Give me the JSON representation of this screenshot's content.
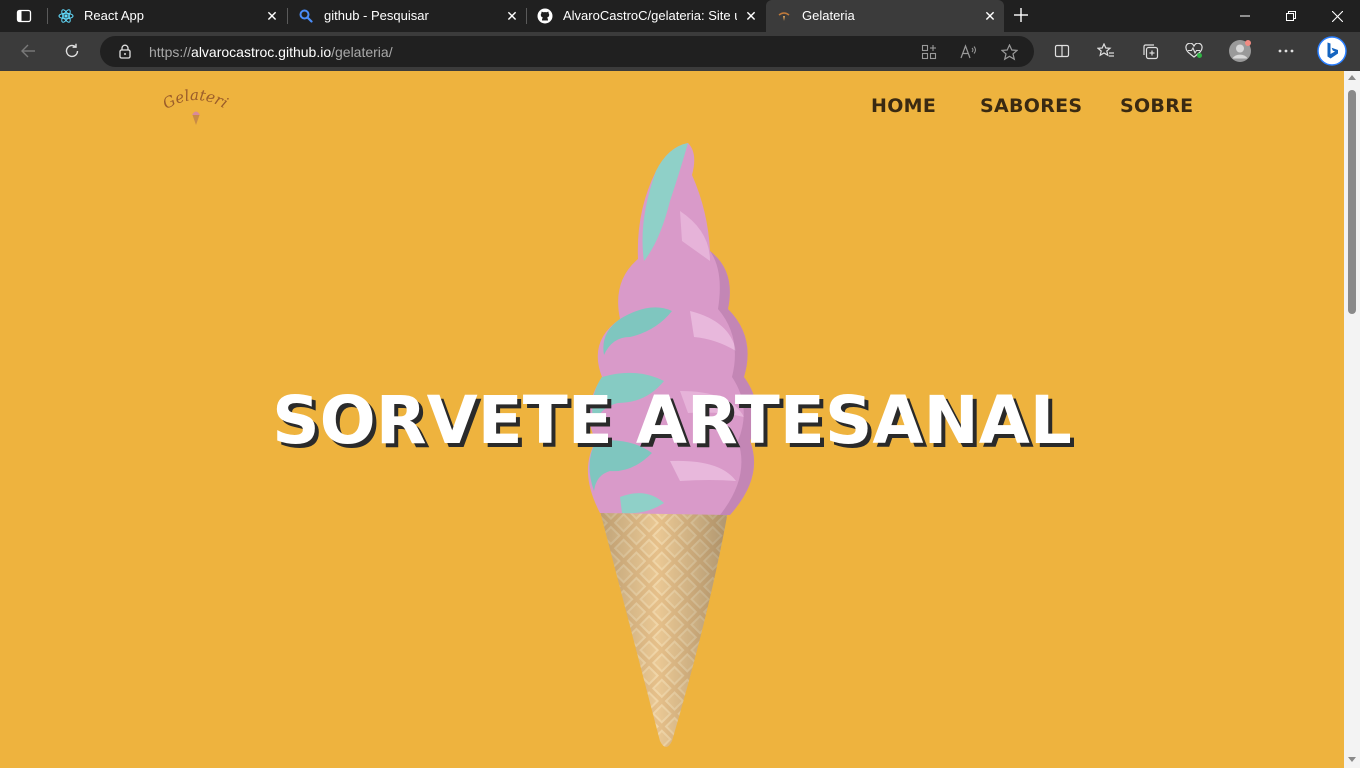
{
  "browser": {
    "tabs": [
      {
        "title": "React App",
        "icon": "react-icon",
        "active": false
      },
      {
        "title": "github - Pesquisar",
        "icon": "search-icon",
        "active": false
      },
      {
        "title": "AlvaroCastroC/gelateria: Site usa",
        "icon": "github-icon",
        "active": false
      },
      {
        "title": "Gelateria",
        "icon": "gelateria-favicon",
        "active": true
      }
    ],
    "url_prefix": "https://",
    "url_host": "alvarocastroc.github.io",
    "url_path": "/gelateria/"
  },
  "page": {
    "logo_text": "Gelateria",
    "nav": [
      {
        "label": "HOME"
      },
      {
        "label": "SABORES"
      },
      {
        "label": "SOBRE"
      }
    ],
    "hero_title": "SORVETE ARTESANAL",
    "background_color": "#EEB33E",
    "nav_color": "#3a2a12"
  }
}
